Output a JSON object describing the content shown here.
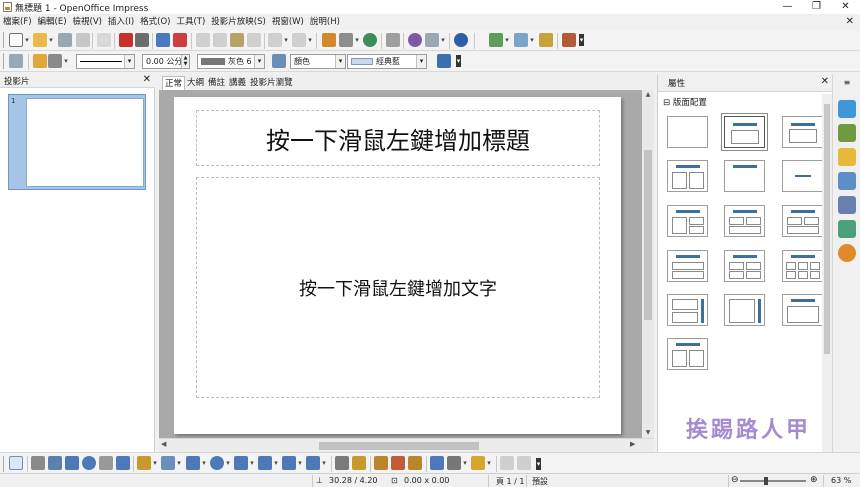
{
  "window": {
    "title": "無標題 1 - OpenOffice Impress",
    "minimize": "—",
    "restore": "❐",
    "close": "✕"
  },
  "menu": [
    "檔案(F)",
    "編輯(E)",
    "檢視(V)",
    "插入(I)",
    "格式(O)",
    "工具(T)",
    "投影片放映(S)",
    "視窗(W)",
    "說明(H)"
  ],
  "menu_close": "✕",
  "line_toolbar": {
    "line_width": "0.00 公分",
    "line_color": "灰色 6",
    "area_style": "顏色",
    "area_fill": "經典藍"
  },
  "slide_pane": {
    "title": "投影片",
    "close": "✕",
    "slide_number": "1"
  },
  "view_tabs": [
    "正常",
    "大綱",
    "備註",
    "講義",
    "投影片瀏覽"
  ],
  "slide": {
    "title_placeholder": "按一下滑鼠左鍵增加標題",
    "body_placeholder": "按一下滑鼠左鍵增加文字"
  },
  "properties": {
    "title": "屬性",
    "close": "✕",
    "section": "版面配置",
    "section_toggle": "⊟"
  },
  "statusbar": {
    "position": "30.28 / 4.20",
    "size": "0.00 x 0.00",
    "page": "頁 1 / 1",
    "master": "預設",
    "zoom_out": "⊖",
    "zoom_in": "⊕",
    "zoom": "63 %"
  },
  "colors": {
    "accent": "#3f6f9f",
    "thumb_selection": "#a6c4e6"
  }
}
